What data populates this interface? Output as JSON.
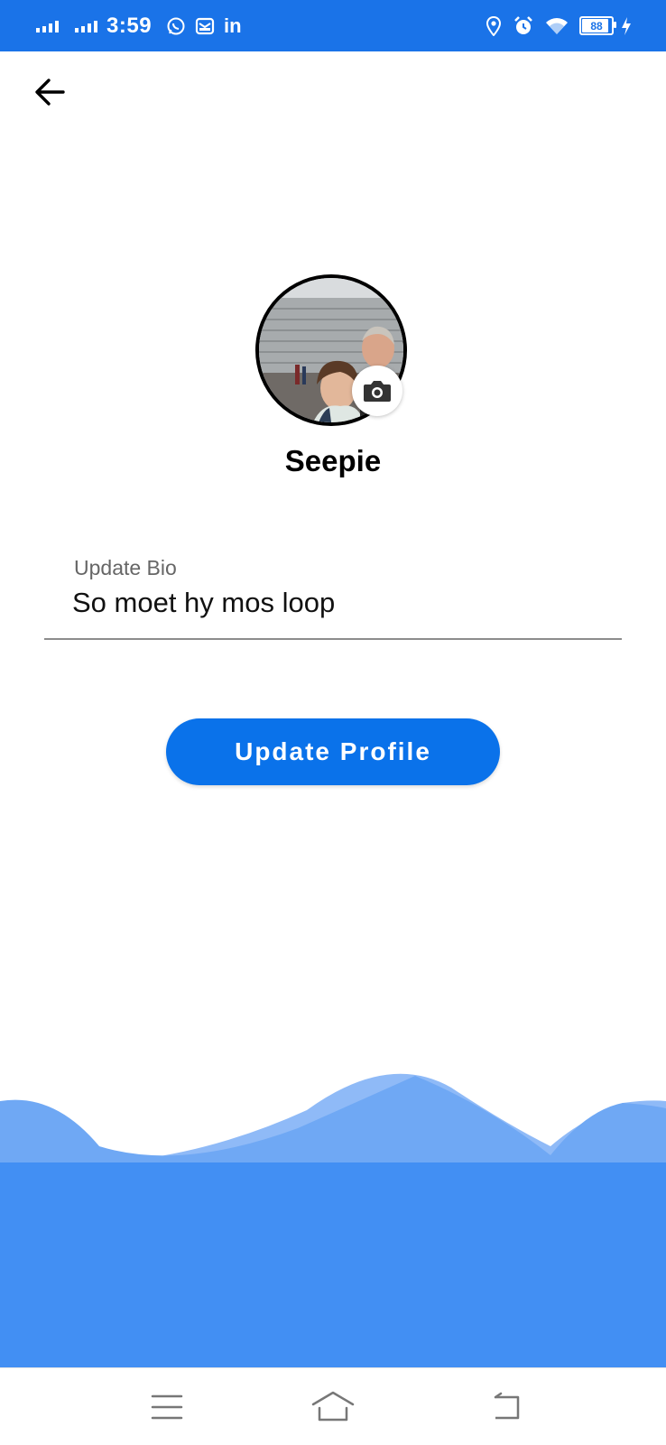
{
  "status_bar": {
    "time": "3:59",
    "battery": "88",
    "icons": [
      "signal-icon",
      "signal-icon",
      "whatsapp-icon",
      "mail-icon",
      "linkedin-icon",
      "location-icon",
      "alarm-icon",
      "wifi-icon",
      "battery-icon",
      "charging-icon"
    ],
    "linkedin_text": "in",
    "color": "#1a73e8"
  },
  "header": {
    "back_icon": "arrow-left-icon"
  },
  "profile": {
    "name": "Seepie",
    "avatar_icon": "profile-photo",
    "camera_icon": "camera-icon"
  },
  "bio": {
    "label": "Update Bio",
    "value": "So moet hy mos loop"
  },
  "actions": {
    "update_label": "Update Profile",
    "accent": "#0a72ea"
  },
  "decoration": {
    "wave_colors": [
      "#428ff3",
      "#6fa8f4",
      "#8fbaf7"
    ]
  },
  "nav_bar": {
    "icons": [
      "menu-icon",
      "home-icon",
      "back-icon"
    ]
  }
}
